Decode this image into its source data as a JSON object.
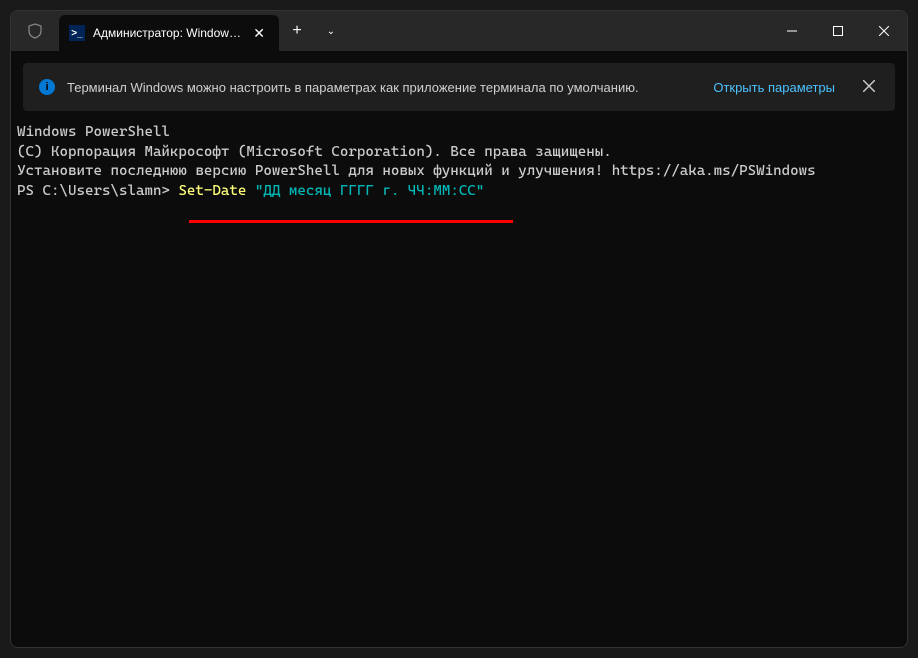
{
  "titlebar": {
    "tab_title": "Администратор: Windows Po",
    "tab_close": "✕",
    "new_tab": "+",
    "dropdown": "⌄"
  },
  "notification": {
    "text": "Терминал Windows можно настроить в параметрах как приложение терминала по умолчанию.",
    "link": "Открыть параметры",
    "close": "✕"
  },
  "terminal": {
    "line1": "Windows PowerShell",
    "line2": "(C) Корпорация Майкрософт (Microsoft Corporation). Все права защищены.",
    "line3": "",
    "line4": "Установите последнюю версию PowerShell для новых функций и улучшения! https://aka.ms/PSWindows",
    "line5": "",
    "prompt": "PS C:\\Users\\slamn> ",
    "cmd_part1": "Set-Date ",
    "cmd_part2": "\"ДД месяц ГГГГ г. ЧЧ:ММ:СС\""
  }
}
